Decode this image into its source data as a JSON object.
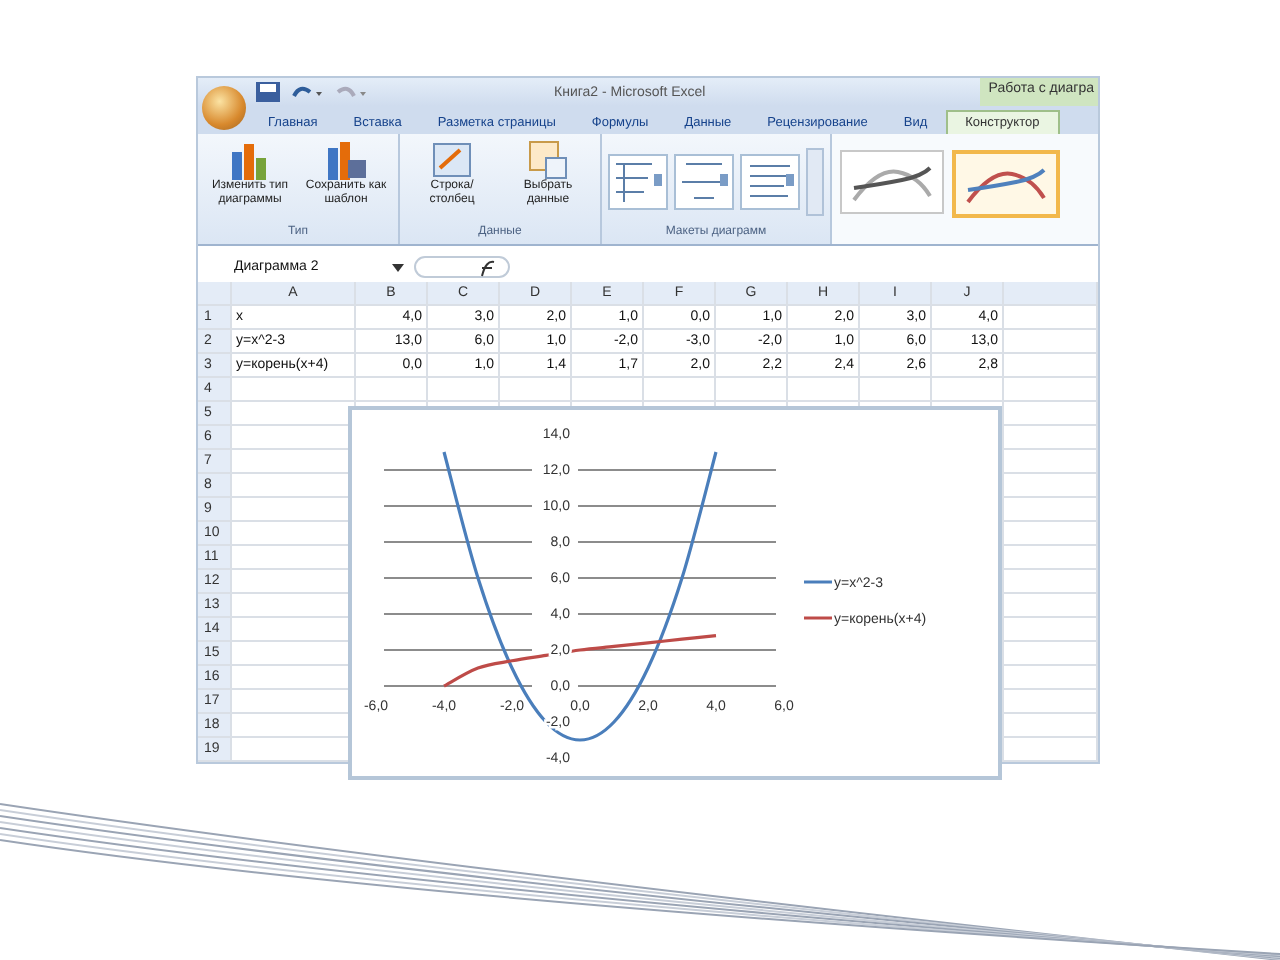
{
  "window": {
    "title": "Книга2 - Microsoft Excel",
    "context_title": "Работа с диагра"
  },
  "tabs": [
    {
      "label": "Главная",
      "selected": false
    },
    {
      "label": "Вставка",
      "selected": false
    },
    {
      "label": "Разметка страницы",
      "selected": false
    },
    {
      "label": "Формулы",
      "selected": false
    },
    {
      "label": "Данные",
      "selected": false
    },
    {
      "label": "Рецензирование",
      "selected": false
    },
    {
      "label": "Вид",
      "selected": false
    },
    {
      "label": "Конструктор",
      "selected": true
    }
  ],
  "ribbon_groups": [
    {
      "label": "Тип",
      "buttons": [
        {
          "label": "Изменить тип диаграммы",
          "kind": "chart"
        },
        {
          "label": "Сохранить как шаблон",
          "kind": "save"
        }
      ]
    },
    {
      "label": "Данные",
      "buttons": [
        {
          "label": "Строка/столбец",
          "kind": "switch"
        },
        {
          "label": "Выбрать данные",
          "kind": "table"
        }
      ]
    }
  ],
  "layouts_group": {
    "label": "Макеты диаграмм"
  },
  "chart_styles": [
    {
      "selected": false
    },
    {
      "selected": true
    }
  ],
  "formula_bar": {
    "name_box": "Диаграмма 2"
  },
  "sheet": {
    "columns": [
      "A",
      "B",
      "C",
      "D",
      "E",
      "F",
      "G",
      "H",
      "I",
      "J"
    ],
    "rows": [
      {
        "number": "1",
        "cells": [
          "x",
          "4,0",
          "3,0",
          "2,0",
          "1,0",
          "0,0",
          "1,0",
          "2,0",
          "3,0",
          "4,0"
        ]
      },
      {
        "number": "2",
        "cells": [
          "y=x^2-3",
          "13,0",
          "6,0",
          "1,0",
          "-2,0",
          "-3,0",
          "-2,0",
          "1,0",
          "6,0",
          "13,0"
        ]
      },
      {
        "number": "3",
        "cells": [
          "y=корень(x+4)",
          "0,0",
          "1,0",
          "1,4",
          "1,7",
          "2,0",
          "2,2",
          "2,4",
          "2,6",
          "2,8"
        ]
      }
    ],
    "empty_rows": [
      "4",
      "5",
      "6",
      "7",
      "8",
      "9",
      "10",
      "11",
      "12",
      "13",
      "14",
      "15",
      "16",
      "17",
      "18",
      "19"
    ]
  },
  "chart": {
    "chart_data": {
      "type": "line",
      "x": [
        -4,
        -3,
        -2,
        -1,
        0,
        1,
        2,
        3,
        4
      ],
      "series": [
        {
          "name": "y=x^2-3",
          "color": "#4a7ebb",
          "values": [
            13,
            6,
            1,
            -2,
            -3,
            -2,
            1,
            6,
            13
          ]
        },
        {
          "name": "y=корень(x+4)",
          "color": "#be4b48",
          "values": [
            0,
            1,
            1.4,
            1.7,
            2,
            2.2,
            2.4,
            2.6,
            2.8
          ]
        }
      ],
      "xlim": [
        -6,
        6
      ],
      "ylim": [
        -4,
        14
      ],
      "grid": true,
      "legend": "right",
      "xticks": [
        {
          "value": -6,
          "label": "-6,0"
        },
        {
          "value": -4,
          "label": "-4,0"
        },
        {
          "value": -2,
          "label": "-2,0"
        },
        {
          "value": 0,
          "label": "0,0"
        },
        {
          "value": 2,
          "label": "2,0"
        },
        {
          "value": 4,
          "label": "4,0"
        },
        {
          "value": 6,
          "label": "6,0"
        }
      ],
      "yticks": [
        {
          "value": -4,
          "label": "-4,0"
        },
        {
          "value": -2,
          "label": "-2,0"
        },
        {
          "value": 0,
          "label": "0,0"
        },
        {
          "value": 2,
          "label": "2,0"
        },
        {
          "value": 4,
          "label": "4,0"
        },
        {
          "value": 6,
          "label": "6,0"
        },
        {
          "value": 8,
          "label": "8,0"
        },
        {
          "value": 10,
          "label": "10,0"
        },
        {
          "value": 12,
          "label": "12,0"
        },
        {
          "value": 14,
          "label": "14,0"
        }
      ]
    }
  }
}
